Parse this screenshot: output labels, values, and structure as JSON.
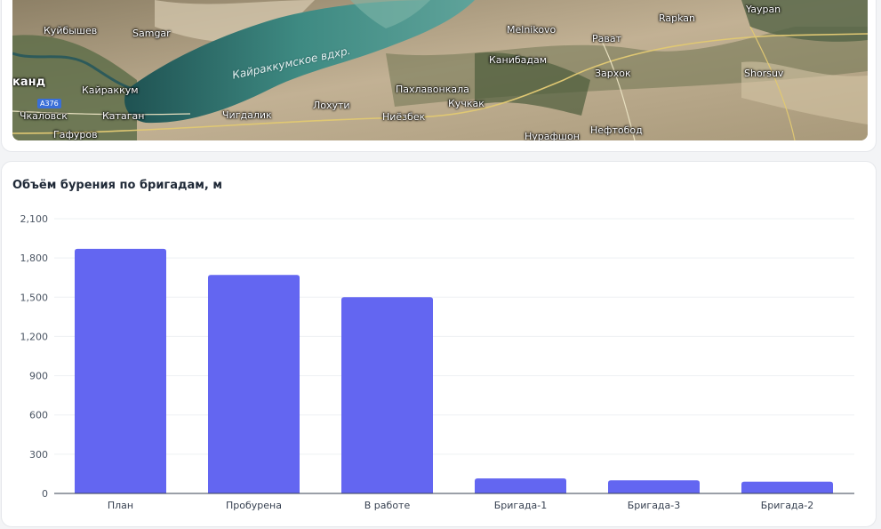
{
  "map": {
    "labels": [
      {
        "text": "Куйбышев",
        "cls": ""
      },
      {
        "text": "Samgar",
        "cls": ""
      },
      {
        "text": "Кайраккумское вдхр.",
        "cls": "water"
      },
      {
        "text": "канд",
        "cls": "big"
      },
      {
        "text": "Кайраккум",
        "cls": ""
      },
      {
        "text": "Чкаловск",
        "cls": ""
      },
      {
        "text": "Катаган",
        "cls": ""
      },
      {
        "text": "Гафуров",
        "cls": ""
      },
      {
        "text": "Чигдалик",
        "cls": ""
      },
      {
        "text": "Лохути",
        "cls": ""
      },
      {
        "text": "Ниёзбек",
        "cls": ""
      },
      {
        "text": "Пахлавонкала",
        "cls": ""
      },
      {
        "text": "Кучкак",
        "cls": ""
      },
      {
        "text": "Melnikovo",
        "cls": ""
      },
      {
        "text": "Канибадам",
        "cls": ""
      },
      {
        "text": "Рават",
        "cls": ""
      },
      {
        "text": "Зархок",
        "cls": ""
      },
      {
        "text": "Rapkan",
        "cls": ""
      },
      {
        "text": "Yaypan",
        "cls": ""
      },
      {
        "text": "Shorsuv",
        "cls": ""
      },
      {
        "text": "Нефтобод",
        "cls": ""
      },
      {
        "text": "Нурафшон",
        "cls": ""
      }
    ],
    "road_badge": "A376"
  },
  "chart_title": "Объём бурения по бригадам, м",
  "chart_data": {
    "type": "bar",
    "title": "Объём бурения по бригадам, м",
    "categories": [
      "План",
      "Пробурена",
      "В работе",
      "Бригада-1",
      "Бригада-3",
      "Бригада-2"
    ],
    "values": [
      1870,
      1670,
      1500,
      115,
      100,
      90
    ],
    "ylim": [
      0,
      2100
    ],
    "yticks": [
      0,
      300,
      600,
      900,
      1200,
      1500,
      1800,
      2100
    ],
    "ytick_labels": [
      "0",
      "300",
      "600",
      "900",
      "1,200",
      "1,500",
      "1,800",
      "2,100"
    ],
    "xlabel": "",
    "ylabel": "",
    "grid": true,
    "bar_color": "#6366f1"
  }
}
